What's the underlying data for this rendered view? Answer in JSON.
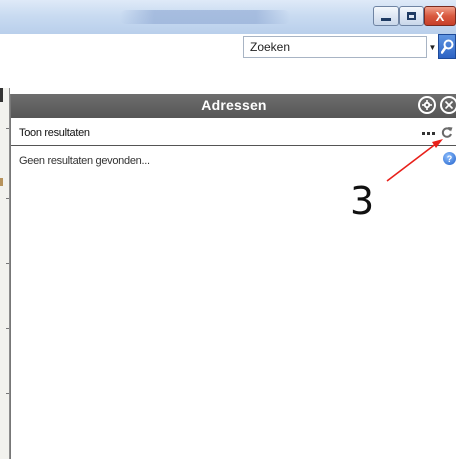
{
  "window": {
    "title": "",
    "minimize_icon": "minimize-icon",
    "maximize_icon": "maximize-icon",
    "close_label": "X"
  },
  "search": {
    "placeholder": "Zoeken",
    "dropdown_icon": "chevron-down-icon",
    "button_icon": "search-icon"
  },
  "panel": {
    "title": "Adressen",
    "settings_icon": "gear-icon",
    "close_icon": "close-icon",
    "results_label": "Toon resultaten",
    "more_icon": "more-icon",
    "refresh_icon": "refresh-icon",
    "empty_message": "Geen resultaten gevonden...",
    "help_icon": "help-icon",
    "help_glyph": "?"
  },
  "annotation": {
    "number": "3",
    "arrow_color": "#e8201a"
  }
}
